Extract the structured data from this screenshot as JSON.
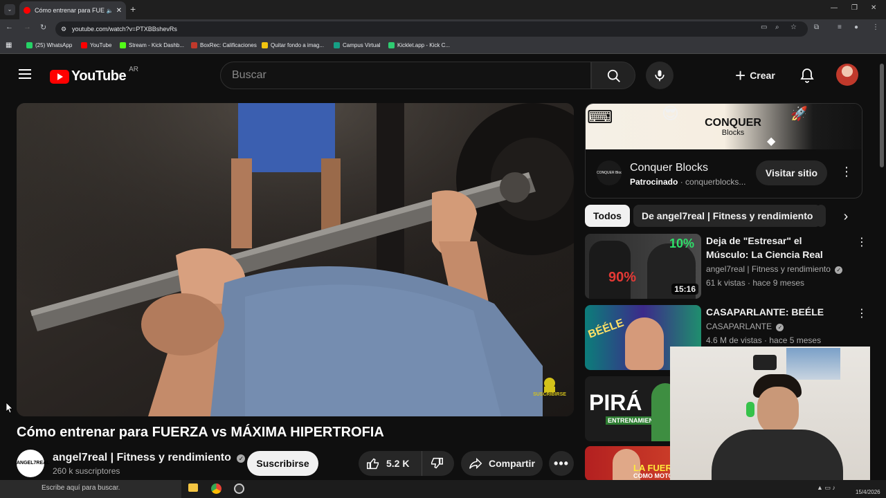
{
  "browser": {
    "tab_title": "Cómo entrenar para FUERZA",
    "url": "youtube.com/watch?v=PTXBBshevRs",
    "bookmarks": [
      {
        "label": "(25) WhatsApp",
        "color": "#25d366"
      },
      {
        "label": "YouTube",
        "color": "#ff0000"
      },
      {
        "label": "Stream - Kick Dashb...",
        "color": "#53fc18"
      },
      {
        "label": "BoxRec: Calificaciones",
        "color": "#c0392b"
      },
      {
        "label": "Quitar fondo a imag...",
        "color": "#f1c40f"
      },
      {
        "label": "Campus Virtual",
        "color": "#16a085"
      },
      {
        "label": "Kicklet.app - Kick C...",
        "color": "#2ecc71"
      }
    ]
  },
  "header": {
    "logo": "YouTube",
    "region": "AR",
    "search_placeholder": "Buscar",
    "create_label": "Crear"
  },
  "video": {
    "title": "Cómo entrenar para FUERZA vs MÁXIMA HIPERTROFIA",
    "watermark": "SUSCRIBIRSE",
    "channel": {
      "name": "angel7real | Fitness y rendimiento",
      "subscribers": "260 k suscriptores",
      "avatar_text": "ANGEL7REAL"
    },
    "subscribe_label": "Suscribirse",
    "likes": "5.2 K",
    "share_label": "Compartir"
  },
  "ad": {
    "brand": "CONQUER",
    "brand_sub": "Blocks",
    "name": "Conquer Blocks",
    "sponsored": "Patrocinado",
    "domain": "conquerblocks...",
    "cta": "Visitar sitio",
    "avatar_text": "CONQUER Blocks"
  },
  "chips": [
    {
      "label": "Todos",
      "active": true
    },
    {
      "label": "De angel7real | Fitness y rendimiento",
      "active": false
    }
  ],
  "recommendations": [
    {
      "title": "Deja de \"Estresar\" el Músculo: La Ciencia Real para Ganar ...",
      "channel": "angel7real | Fitness y rendimiento",
      "stats": "61 k vistas · hace 9 meses",
      "duration": "15:16",
      "thumb_text_1": "10%",
      "thumb_text_2": "90%"
    },
    {
      "title": "CASAPARLANTE: BEÉLE",
      "channel": "CASAPARLANTE",
      "stats": "4.6 M de vistas · hace 5 meses",
      "thumb_text_1": "BÉÉLE"
    },
    {
      "thumb_text_1": "PIRÁ",
      "thumb_text_2": "ENTRENAMIEN"
    },
    {
      "thumb_text_1": "LA FUERZA",
      "thumb_text_2": "COMO MOTOR"
    }
  ],
  "taskbar": {
    "search_placeholder": "Escribe aquí para buscar.",
    "date": "15/4/2026"
  }
}
